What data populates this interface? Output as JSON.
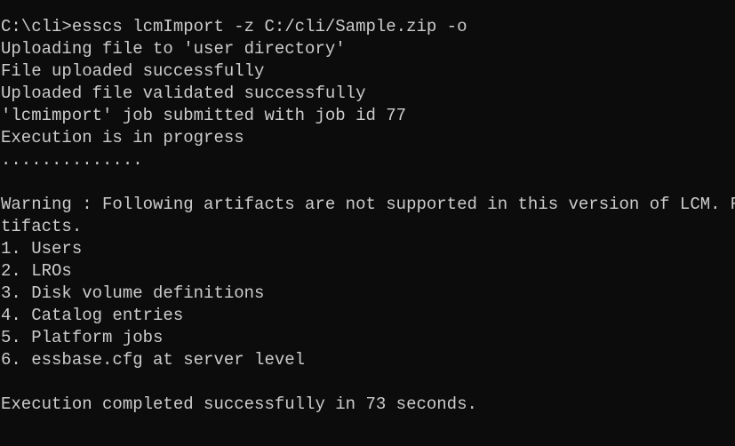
{
  "terminal": {
    "lines": [
      "C:\\cli>esscs lcmImport -z C:/cli/Sample.zip -o",
      "Uploading file to 'user directory'",
      "File uploaded successfully",
      "Uploaded file validated successfully",
      "'lcmimport' job submitted with job id 77",
      "Execution is in progress",
      "..............",
      "",
      "Warning : Following artifacts are not supported in this version of LCM. R",
      "tifacts.",
      "1. Users",
      "2. LROs",
      "3. Disk volume definitions",
      "4. Catalog entries",
      "5. Platform jobs",
      "6. essbase.cfg at server level",
      "",
      "Execution completed successfully in 73 seconds."
    ]
  }
}
